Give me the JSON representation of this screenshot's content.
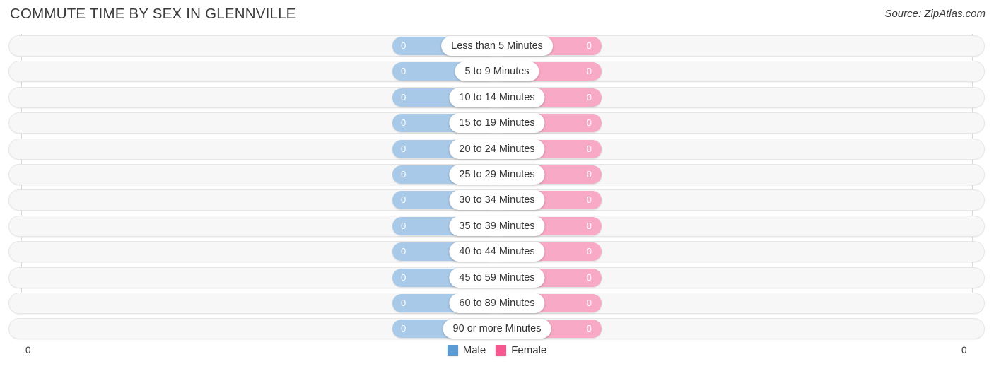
{
  "header": {
    "title": "COMMUTE TIME BY SEX IN GLENNVILLE",
    "source": "Source: ZipAtlas.com"
  },
  "axis": {
    "left_label": "0",
    "right_label": "0"
  },
  "legend": {
    "items": [
      {
        "label": "Male",
        "color": "#5b9bd5",
        "icon": "square-swatch"
      },
      {
        "label": "Female",
        "color": "#f4588f",
        "icon": "square-swatch"
      }
    ]
  },
  "colors": {
    "male_bar": "#a9c9e8",
    "female_bar": "#f7a9c5",
    "male_legend": "#5b9bd5",
    "female_legend": "#f4588f",
    "row_track": "#f7f7f7",
    "gridline": "#d9d9d9"
  },
  "chart_data": {
    "type": "bar",
    "orientation": "horizontal-diverging",
    "title": "COMMUTE TIME BY SEX IN GLENNVILLE",
    "subtitle": "Source: ZipAtlas.com",
    "xlabel": "",
    "ylabel": "",
    "xlim": [
      0,
      0
    ],
    "axis_ticks": [
      "0",
      "0"
    ],
    "grid": true,
    "legend_position": "bottom-center",
    "categories": [
      "Less than 5 Minutes",
      "5 to 9 Minutes",
      "10 to 14 Minutes",
      "15 to 19 Minutes",
      "20 to 24 Minutes",
      "25 to 29 Minutes",
      "30 to 34 Minutes",
      "35 to 39 Minutes",
      "40 to 44 Minutes",
      "45 to 59 Minutes",
      "60 to 89 Minutes",
      "90 or more Minutes"
    ],
    "series": [
      {
        "name": "Male",
        "color": "#a9c9e8",
        "values": [
          0,
          0,
          0,
          0,
          0,
          0,
          0,
          0,
          0,
          0,
          0,
          0
        ],
        "value_labels": [
          "0",
          "0",
          "0",
          "0",
          "0",
          "0",
          "0",
          "0",
          "0",
          "0",
          "0",
          "0"
        ]
      },
      {
        "name": "Female",
        "color": "#f7a9c5",
        "values": [
          0,
          0,
          0,
          0,
          0,
          0,
          0,
          0,
          0,
          0,
          0,
          0
        ],
        "value_labels": [
          "0",
          "0",
          "0",
          "0",
          "0",
          "0",
          "0",
          "0",
          "0",
          "0",
          "0",
          "0"
        ]
      }
    ]
  }
}
